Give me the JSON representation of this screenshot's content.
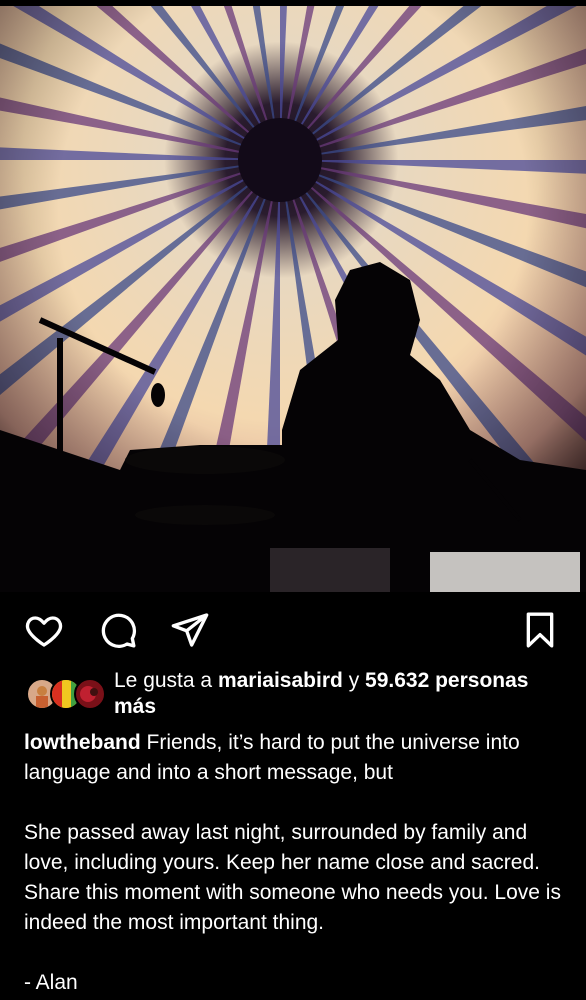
{
  "post": {
    "image_icon": "concert-photo-starburst",
    "actions": {
      "like_icon": "heart-icon",
      "comment_icon": "comment-icon",
      "share_icon": "send-icon",
      "save_icon": "bookmark-icon"
    },
    "likes": {
      "prefix": "Le gusta a",
      "user": "mariaisabird",
      "joiner": "y",
      "count": "59.632",
      "suffix": "personas más"
    },
    "caption": {
      "username": "lowtheband",
      "line1": "Friends, it’s hard to put the universe into language and into a short message, but",
      "paragraph2": "She passed away last night, surrounded by family and love, including yours. Keep her name close and sacred. Share this moment with someone who needs you. Love is indeed the most important thing.",
      "signature": "- Alan"
    }
  }
}
